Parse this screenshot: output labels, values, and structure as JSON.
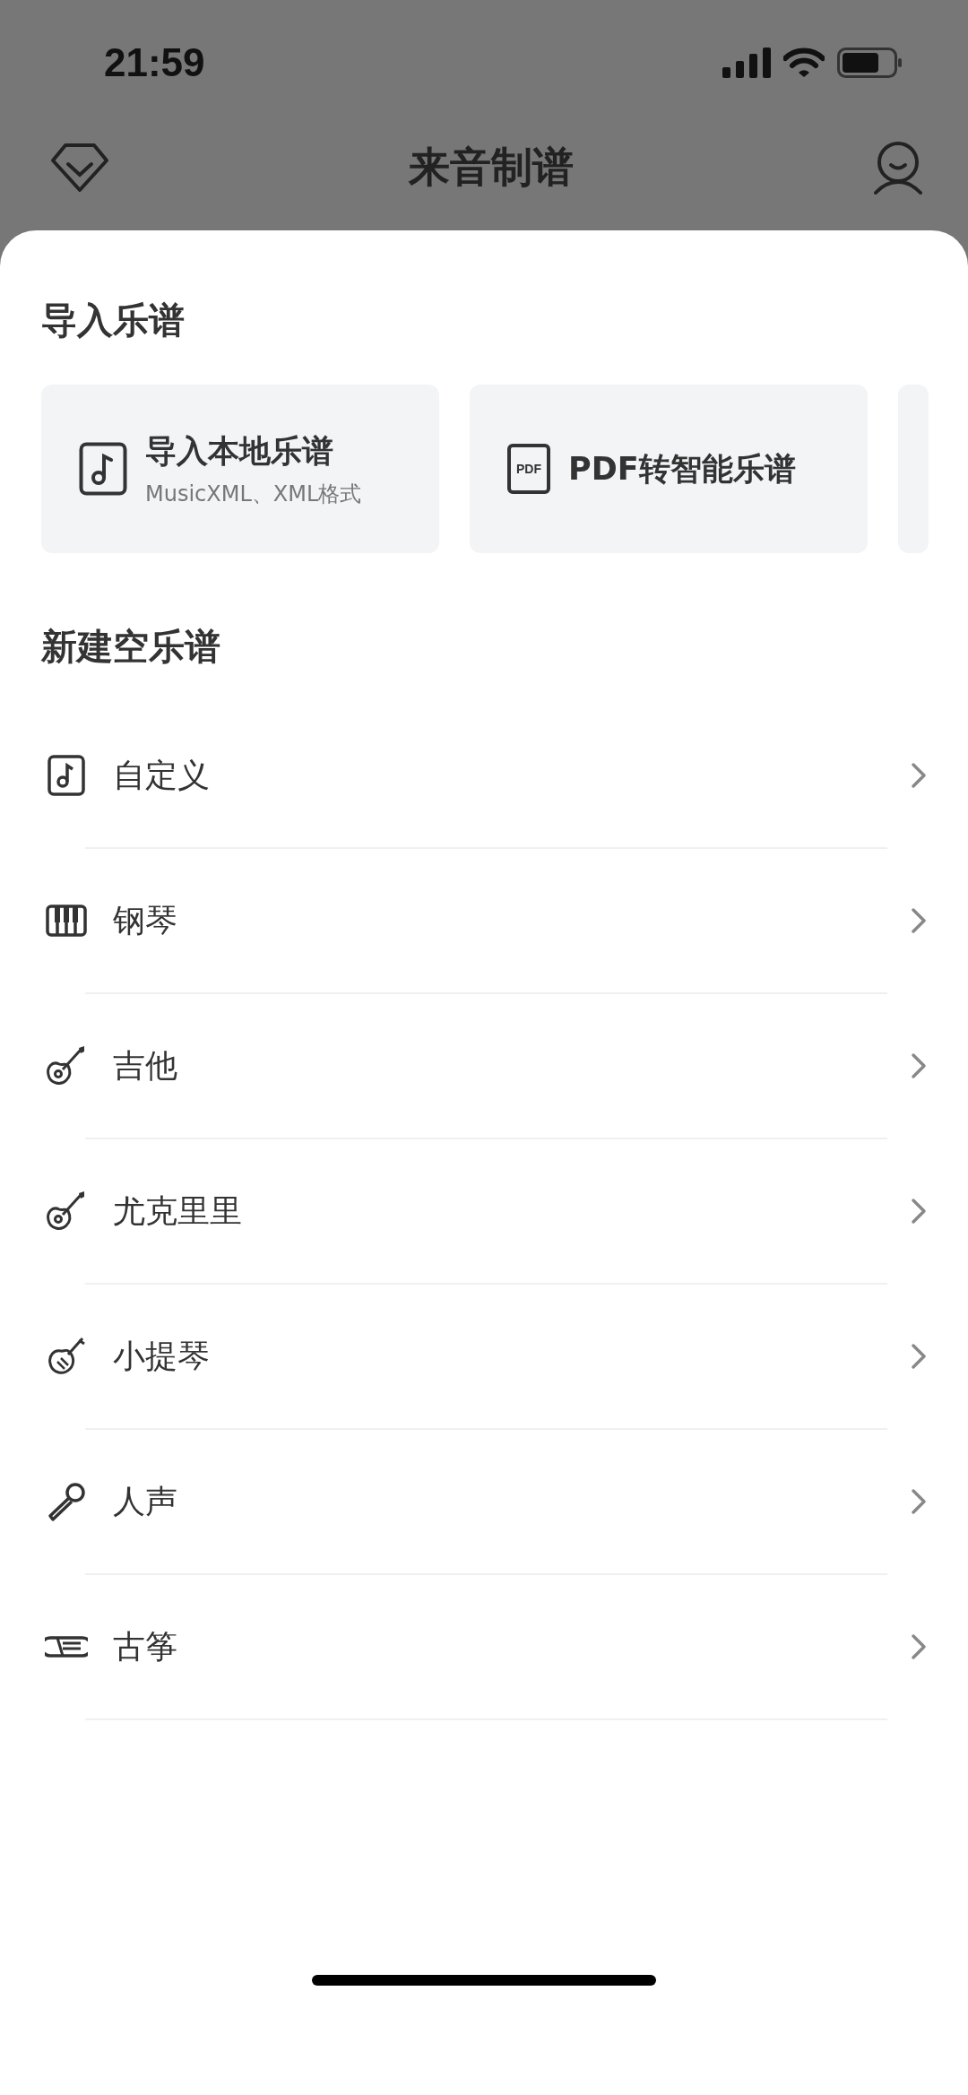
{
  "status_bar": {
    "time": "21:59"
  },
  "nav": {
    "title": "来音制谱"
  },
  "import_section": {
    "title": "导入乐谱",
    "cards": [
      {
        "title": "导入本地乐谱",
        "subtitle": "MusicXML、XML格式"
      },
      {
        "title": "PDF转智能乐谱",
        "icon_text": "PDF"
      }
    ]
  },
  "new_section": {
    "title": "新建空乐谱",
    "items": [
      {
        "label": "自定义"
      },
      {
        "label": "钢琴"
      },
      {
        "label": "吉他"
      },
      {
        "label": "尤克里里"
      },
      {
        "label": "小提琴"
      },
      {
        "label": "人声"
      },
      {
        "label": "古筝"
      }
    ]
  }
}
